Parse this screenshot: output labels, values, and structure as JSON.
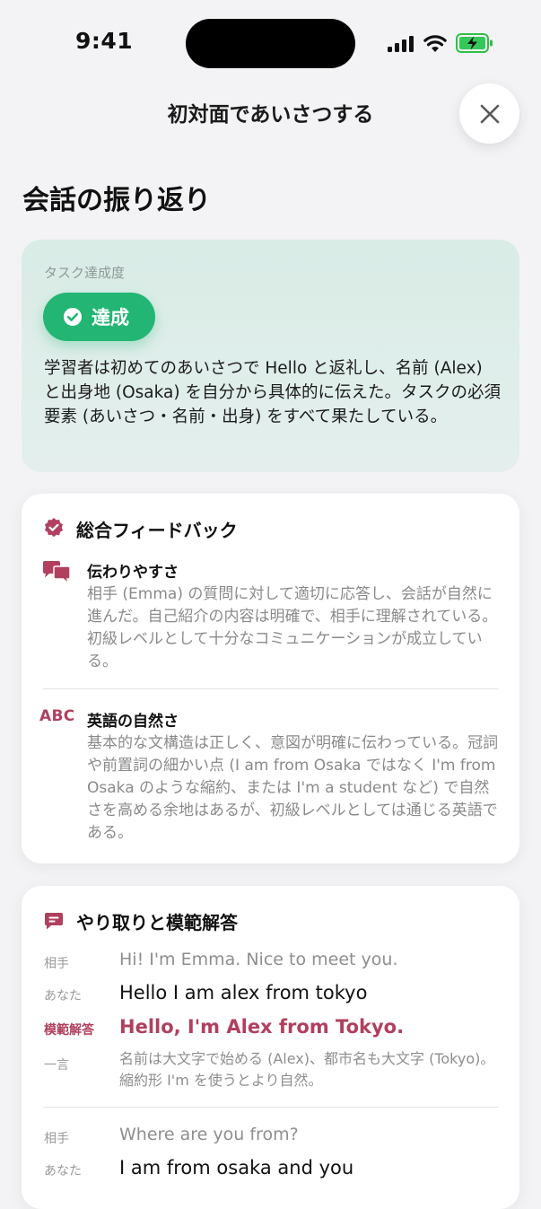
{
  "status_bar": {
    "time": "9:41"
  },
  "header": {
    "title": "初対面であいさつする",
    "close_icon": "close-icon"
  },
  "section_title": "会話の振り返り",
  "task": {
    "label": "タスク達成度",
    "badge": "達成",
    "badge_color": "#22b573",
    "description": "学習者は初めてのあいさつで Hello と返礼し、名前 (Alex) と出身地 (Osaka) を自分から具体的に伝えた。タスクの必須要素 (あいさつ・名前・出身) をすべて果たしている。"
  },
  "feedback": {
    "heading": "総合フィードバック",
    "accent_color": "#b0405e",
    "items": [
      {
        "icon": "chat-bubbles-icon",
        "title": "伝わりやすさ",
        "body": "相手 (Emma) の質問に対して適切に応答し、会話が自然に進んだ。自己紹介の内容は明確で、相手に理解されている。初級レベルとして十分なコミュニケーションが成立している。"
      },
      {
        "icon_text": "ABC",
        "title": "英語の自然さ",
        "body": "基本的な文構造は正しく、意図が明確に伝わっている。冠詞や前置詞の細かい点 (I am from Osaka ではなく I'm from Osaka のような縮約、または I'm a student など) で自然さを高める余地はあるが、初級レベルとしては通じる英語である。"
      }
    ]
  },
  "exchange": {
    "heading": "やり取りと模範解答",
    "labels": {
      "partner": "相手",
      "you": "あなた",
      "model": "模範解答",
      "note": "一言"
    },
    "turns": [
      {
        "partner": "Hi! I'm Emma. Nice to meet you.",
        "you": "Hello I am alex from tokyo",
        "model": "Hello, I'm Alex from Tokyo.",
        "note": "名前は大文字で始める (Alex)、都市名も大文字 (Tokyo)。縮約形 I'm を使うとより自然。"
      },
      {
        "partner": "Where are you from?",
        "you": "I am from osaka and you"
      }
    ]
  }
}
